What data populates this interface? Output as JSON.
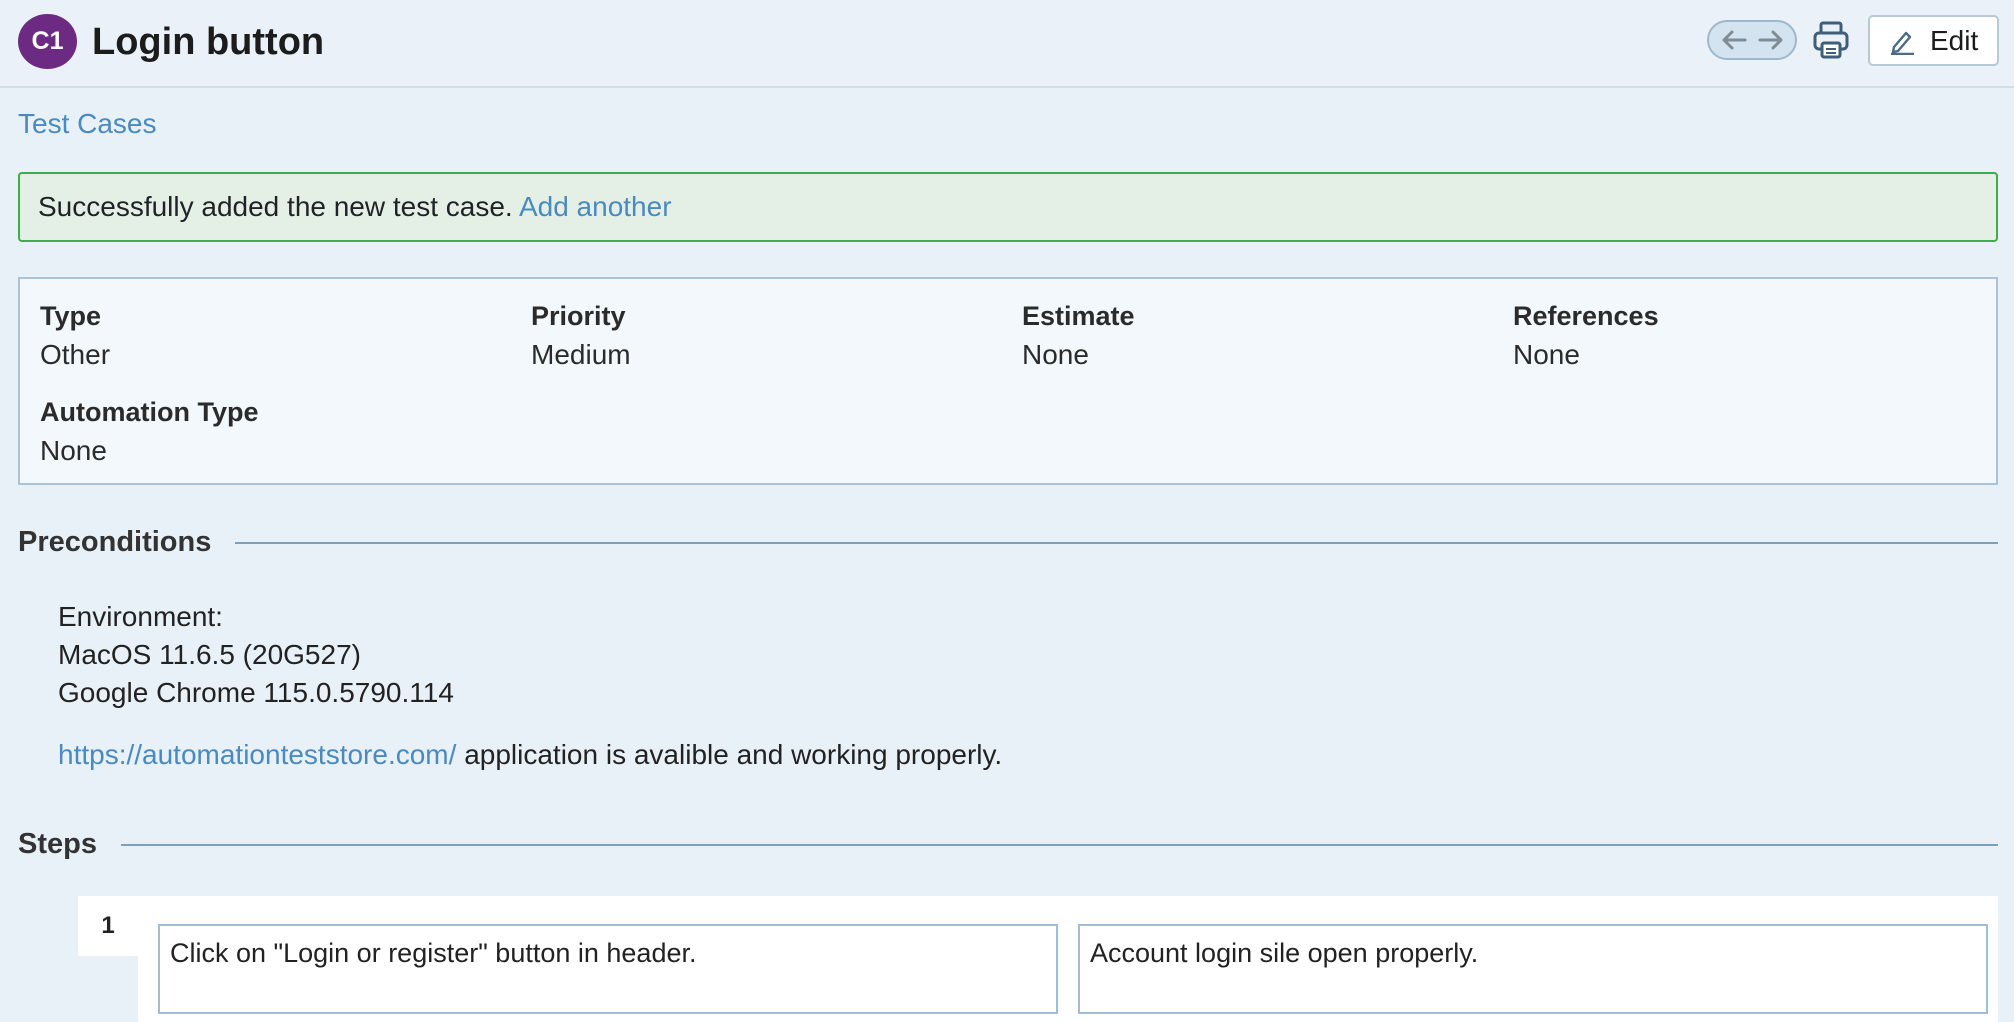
{
  "header": {
    "badge": "C1",
    "title": "Login button",
    "prev_icon": "arrow-left-icon",
    "next_icon": "arrow-right-icon",
    "print_icon": "printer-icon",
    "edit_label": "Edit"
  },
  "breadcrumb": "Test Cases",
  "alert": {
    "message": "Successfully added the new test case.",
    "link": "Add another"
  },
  "info": {
    "type_label": "Type",
    "type_value": "Other",
    "priority_label": "Priority",
    "priority_value": "Medium",
    "estimate_label": "Estimate",
    "estimate_value": "None",
    "references_label": "References",
    "references_value": "None",
    "automation_label": "Automation Type",
    "automation_value": "None"
  },
  "preconditions": {
    "heading": "Preconditions",
    "line1": "Environment:",
    "line2": "MacOS 11.6.5 (20G527)",
    "line3": "Google Chrome 115.0.5790.114",
    "link": "https://automationteststore.com/",
    "tail": " application is avalible and working properly."
  },
  "steps": {
    "heading": "Steps",
    "items": [
      {
        "number": "1",
        "content": "Click on \"Login or register\" button in header.",
        "expected": "Account login sile open properly."
      }
    ]
  },
  "colors": {
    "badge": "#6d2a83",
    "link": "#4a8abf",
    "success_border": "#3cae4a"
  }
}
